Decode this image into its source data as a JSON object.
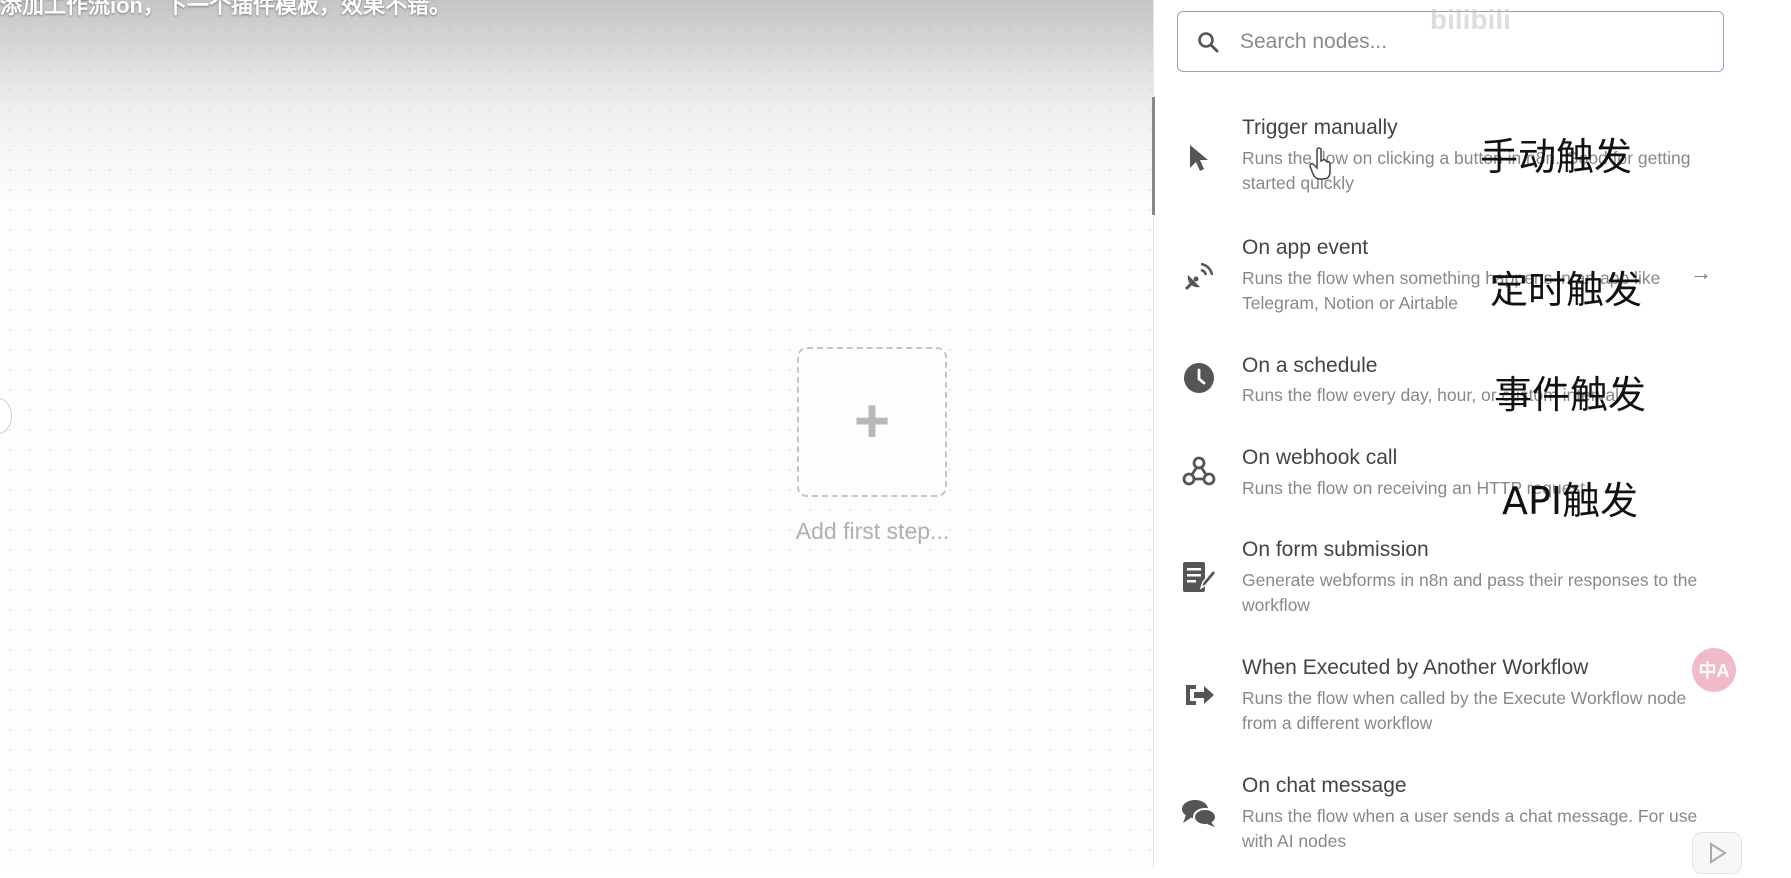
{
  "video_title": "添加工作流ion，下一个插件模板，效果不错。",
  "canvas": {
    "add_first_step": "Add first step..."
  },
  "search": {
    "placeholder": "Search nodes..."
  },
  "nodes": [
    {
      "title": "Trigger manually",
      "desc": "Runs the flow on clicking a button in n8n. Good for getting started quickly",
      "icon": "pointer-icon"
    },
    {
      "title": "On app event",
      "desc": "Runs the flow when something happens in an app like Telegram, Notion or Airtable",
      "icon": "satellite-icon"
    },
    {
      "title": "On a schedule",
      "desc": "Runs the flow every day, hour, or custom interval",
      "icon": "clock-icon"
    },
    {
      "title": "On webhook call",
      "desc": "Runs the flow on receiving an HTTP request",
      "icon": "webhook-icon"
    },
    {
      "title": "On form submission",
      "desc": "Generate webforms in n8n and pass their responses to the workflow",
      "icon": "form-icon"
    },
    {
      "title": "When Executed by Another Workflow",
      "desc": "Runs the flow when called by the Execute Workflow node from a different workflow",
      "icon": "sign-in-icon"
    },
    {
      "title": "On chat message",
      "desc": "Runs the flow when a user sends a chat message. For use with AI nodes",
      "icon": "chat-icon"
    }
  ],
  "app_event_arrow": "→",
  "overlays": {
    "manual": "手动触发",
    "timed": "定时触发",
    "event": "事件触发",
    "api": "API触发"
  },
  "translate_label": "中A",
  "colors": {
    "accent_border": "#9f9fc6",
    "translate_bg": "#f2b9c8"
  }
}
